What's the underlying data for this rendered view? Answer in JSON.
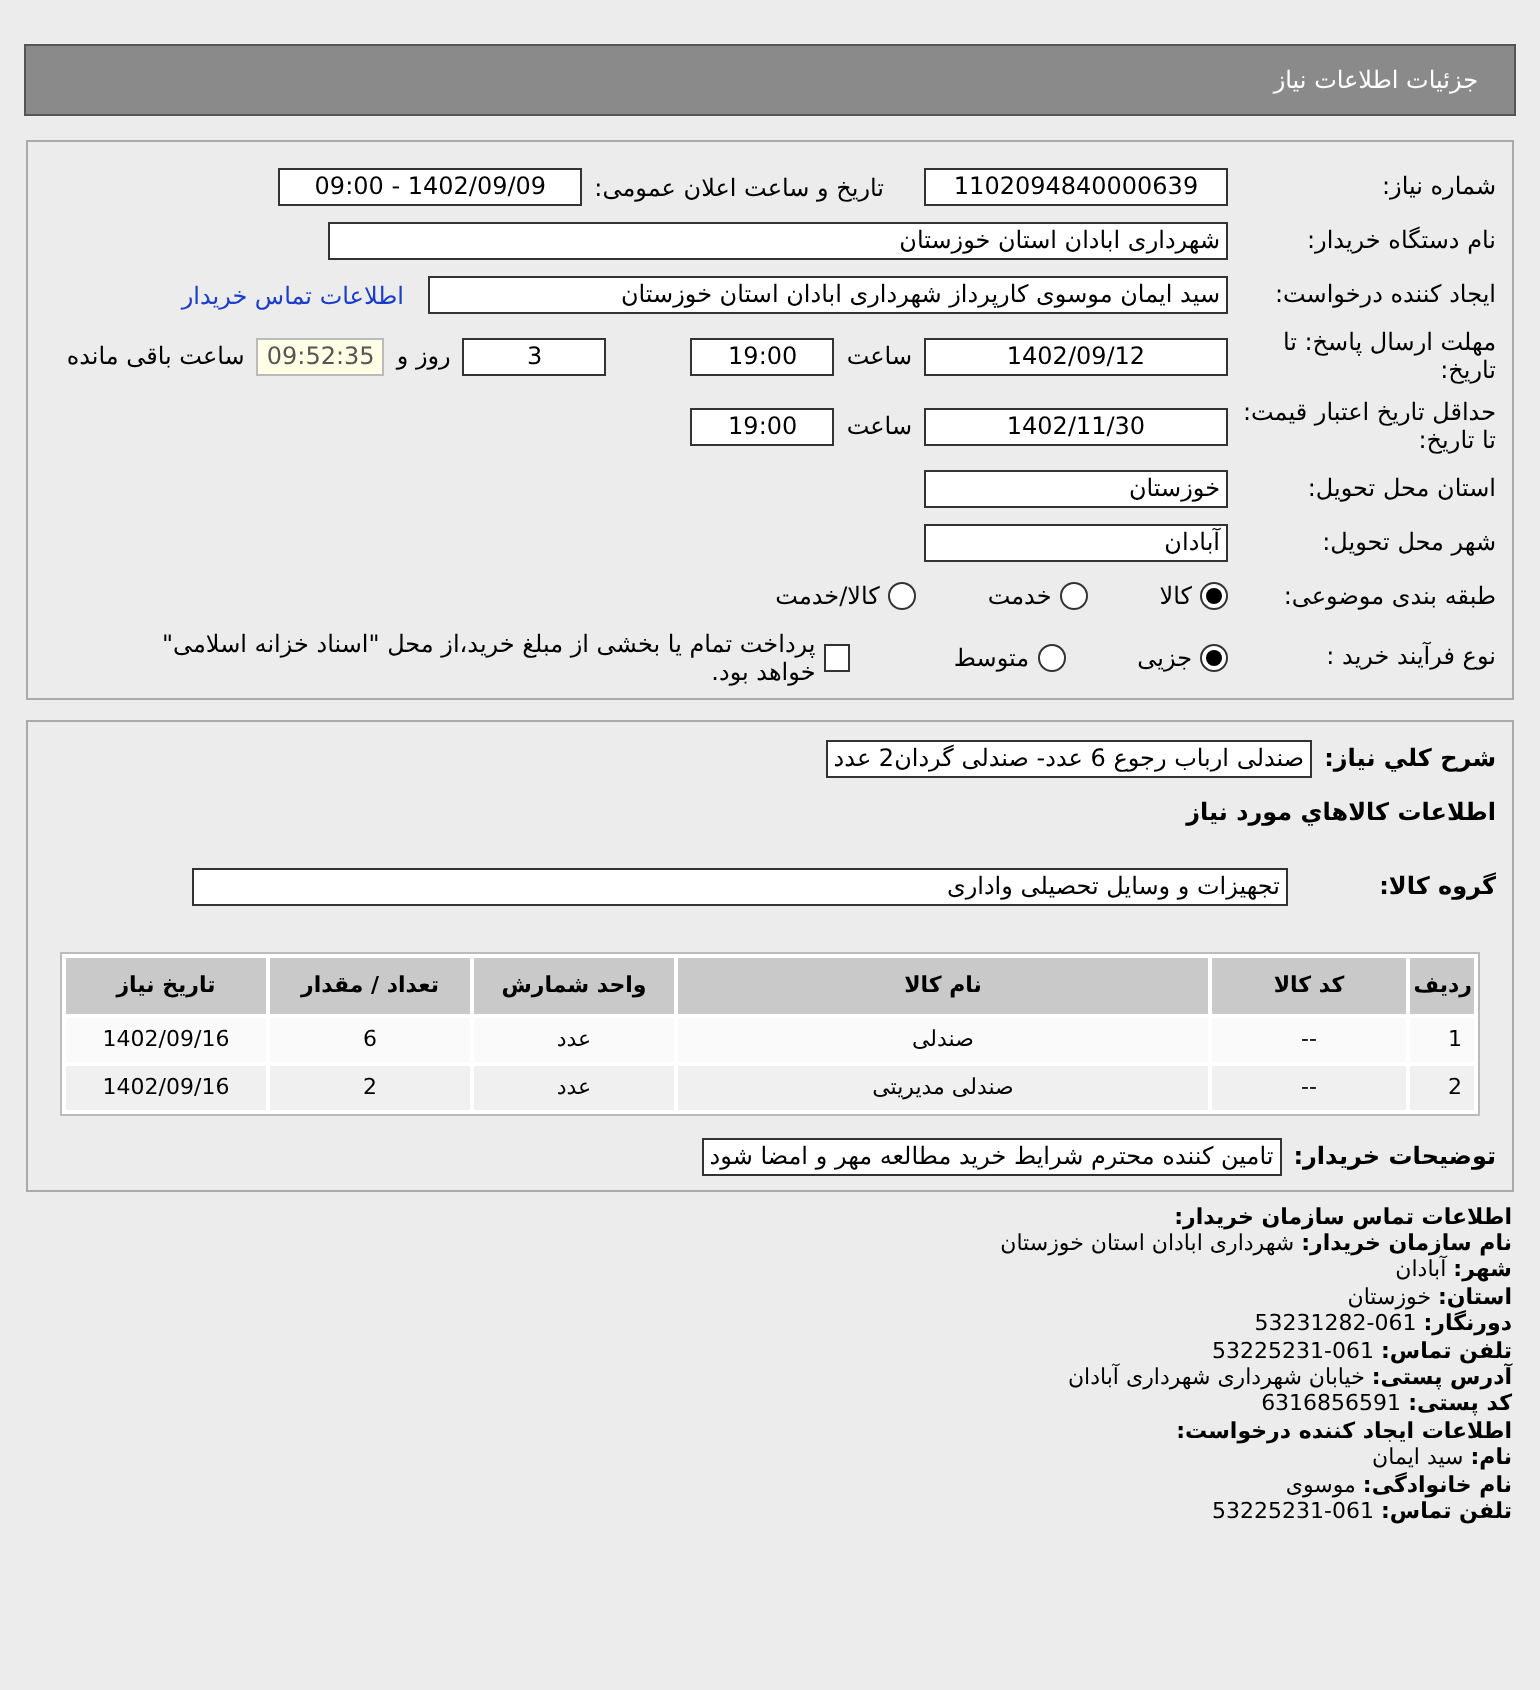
{
  "header": {
    "title": "جزئیات اطلاعات نیاز"
  },
  "main": {
    "need_number": {
      "label": "شماره نیاز:",
      "value": "1102094840000639"
    },
    "announce": {
      "label": "تاریخ و ساعت اعلان عمومی:",
      "value": "1402/09/09 - 09:00"
    },
    "buyer": {
      "label": "نام دستگاه خریدار:",
      "value": "شهرداری ابادان استان خوزستان"
    },
    "creator": {
      "label": "ایجاد کننده درخواست:",
      "value": "سید ایمان موسوی کارپرداز شهرداری ابادان استان خوزستان",
      "link": "اطلاعات تماس خریدار"
    },
    "deadline": {
      "label": "مهلت ارسال پاسخ: تا تاریخ:",
      "date": "1402/09/12",
      "time_label": "ساعت",
      "time": "19:00",
      "days": "3",
      "days_label": "روز و",
      "remaining": "09:52:35",
      "remaining_label": "ساعت باقی مانده"
    },
    "validity": {
      "label": "حداقل تاریخ اعتبار قیمت: تا تاریخ:",
      "date": "1402/11/30",
      "time_label": "ساعت",
      "time": "19:00"
    },
    "province": {
      "label": "استان محل تحویل:",
      "value": "خوزستان"
    },
    "city": {
      "label": "شهر محل تحویل:",
      "value": "آبادان"
    },
    "category": {
      "label": "طبقه بندی موضوعی:",
      "options": [
        {
          "label": "کالا",
          "selected": true
        },
        {
          "label": "خدمت",
          "selected": false
        },
        {
          "label": "کالا/خدمت",
          "selected": false
        }
      ]
    },
    "process": {
      "label": "نوع فرآیند خرید :",
      "options": [
        {
          "label": "جزیی",
          "selected": true
        },
        {
          "label": "متوسط",
          "selected": false
        }
      ],
      "payment": {
        "label": "پرداخت تمام یا بخشی از مبلغ خرید،از محل \"اسناد خزانه اسلامی\" خواهد بود.",
        "checked": false
      }
    }
  },
  "details": {
    "summary": {
      "label": "شرح کلي نياز:",
      "value": "صندلی ارباب رجوع 6 عدد- صندلی گردان2 عدد"
    },
    "goods_title": "اطلاعات کالاهاي مورد نياز",
    "group": {
      "label": "گروه کالا:",
      "value": "تجهیزات و وسایل تحصیلی واداری"
    },
    "table": {
      "columns": [
        "ردیف",
        "کد کالا",
        "نام کالا",
        "واحد شمارش",
        "تعداد / مقدار",
        "تاریخ نیاز"
      ],
      "rows": [
        [
          "1",
          "--",
          "صندلی",
          "عدد",
          "6",
          "1402/09/16"
        ],
        [
          "2",
          "--",
          "صندلی مدیریتی",
          "عدد",
          "2",
          "1402/09/16"
        ]
      ]
    },
    "notes": {
      "label": "توضیحات خریدار:",
      "value": "تامین کننده محترم شرایط خرید مطالعه مهر و امضا شود"
    }
  },
  "contact": [
    {
      "label": "اطلاعات تماس سازمان خریدار:"
    },
    {
      "label": "نام سازمان خریدار:",
      "value": "شهرداری ابادان استان خوزستان"
    },
    {
      "label": "شهر:",
      "value": "آبادان"
    },
    {
      "label": "استان:",
      "value": "خوزستان"
    },
    {
      "label": "دورنگار:",
      "value": "061-53231282"
    },
    {
      "label": "تلفن تماس:",
      "value": "061-53225231"
    },
    {
      "label": "آدرس پستی:",
      "value": "خیابان شهرداری شهرداری آبادان"
    },
    {
      "label": "کد پستی:",
      "value": "6316856591"
    },
    {
      "label": "اطلاعات ایجاد کننده درخواست:"
    },
    {
      "label": "نام:",
      "value": "سید ایمان"
    },
    {
      "label": "نام خانوادگی:",
      "value": "موسوی"
    },
    {
      "label": "تلفن تماس:",
      "value": "061-53225231"
    }
  ]
}
